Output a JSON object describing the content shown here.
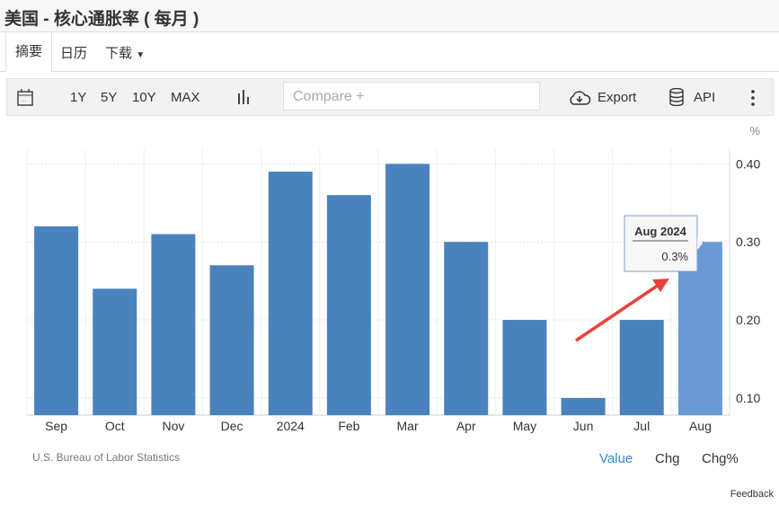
{
  "title": "美国 - 核心通胀率 ( 每月 )",
  "tabs": [
    "摘要",
    "日历",
    "下载"
  ],
  "toolbar": {
    "ranges": [
      "1Y",
      "5Y",
      "10Y",
      "MAX"
    ],
    "compare_placeholder": "Compare +",
    "export": "Export",
    "api": "API"
  },
  "tooltip": {
    "title": "Aug 2024",
    "value": "0.3%"
  },
  "footer": {
    "source": "U.S. Bureau of Labor Statistics",
    "modes": [
      "Value",
      "Chg",
      "Chg%"
    ],
    "feedback": "Feedback"
  },
  "colors": {
    "bar": "#4a82bd",
    "highlight": "#6a9ad6",
    "active_mode": "#2e8ccf",
    "arrow": "#e8433a"
  },
  "chart_data": {
    "type": "bar",
    "categories": [
      "Sep",
      "Oct",
      "Nov",
      "Dec",
      "2024",
      "Feb",
      "Mar",
      "Apr",
      "May",
      "Jun",
      "Jul",
      "Aug"
    ],
    "values": [
      0.32,
      0.24,
      0.31,
      0.27,
      0.39,
      0.36,
      0.4,
      0.3,
      0.2,
      0.1,
      0.2,
      0.3
    ],
    "unit": "%",
    "yticks": [
      "0.10",
      "0.20",
      "0.30",
      "0.40"
    ],
    "ylim": [
      0.078,
      0.42
    ],
    "highlighted": "Aug"
  }
}
